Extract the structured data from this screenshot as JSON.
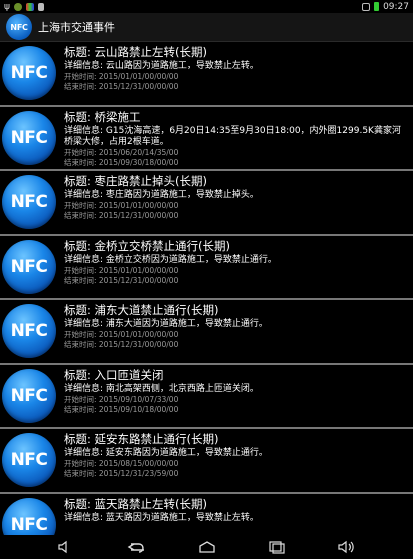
{
  "status_bar": {
    "time": "09:27"
  },
  "app": {
    "title": "上海市交通事件",
    "icon_text": "NFC"
  },
  "events": [
    {
      "title": "标题: 云山路禁止左转(长期)",
      "detail": "详细信息: 云山路因为道路施工，导致禁止左转。",
      "start": "开始时间: 2015/01/01/00/00/00",
      "end": "结束时间: 2015/12/31/00/00/00"
    },
    {
      "title": "标题: 桥梁施工",
      "detail": "详细信息: G15沈海高速，6月20日14:35至9月30日18:00，内外圈1299.5K龚家河桥梁大修，占用2根车道。",
      "start": "开始时间: 2015/06/20/14/35/00",
      "end": "结束时间: 2015/09/30/18/00/00"
    },
    {
      "title": "标题: 枣庄路禁止掉头(长期)",
      "detail": "详细信息: 枣庄路因为道路施工，导致禁止掉头。",
      "start": "开始时间: 2015/01/01/00/00/00",
      "end": "结束时间: 2015/12/31/00/00/00"
    },
    {
      "title": "标题: 金桥立交桥禁止通行(长期)",
      "detail": "详细信息: 金桥立交桥因为道路施工，导致禁止通行。",
      "start": "开始时间: 2015/01/01/00/00/00",
      "end": "结束时间: 2015/12/31/00/00/00"
    },
    {
      "title": "标题: 浦东大道禁止通行(长期)",
      "detail": "详细信息: 浦东大道因为道路施工，导致禁止通行。",
      "start": "开始时间: 2015/01/01/00/00/00",
      "end": "结束时间: 2015/12/31/00/00/00"
    },
    {
      "title": "标题: 入口匝道关闭",
      "detail": "详细信息: 南北高架西侧，北京西路上匝道关闭。",
      "start": "开始时间: 2015/09/10/07/33/00",
      "end": "结束时间: 2015/09/10/18/00/00"
    },
    {
      "title": "标题: 延安东路禁止通行(长期)",
      "detail": "详细信息: 延安东路因为道路施工，导致禁止通行。",
      "start": "开始时间: 2015/08/15/00/00/00",
      "end": "结束时间: 2015/12/31/23/59/00"
    },
    {
      "title": "标题: 蓝天路禁止左转(长期)",
      "detail": "详细信息: 蓝天路因为道路施工，导致禁止左转。",
      "start": "",
      "end": ""
    }
  ]
}
